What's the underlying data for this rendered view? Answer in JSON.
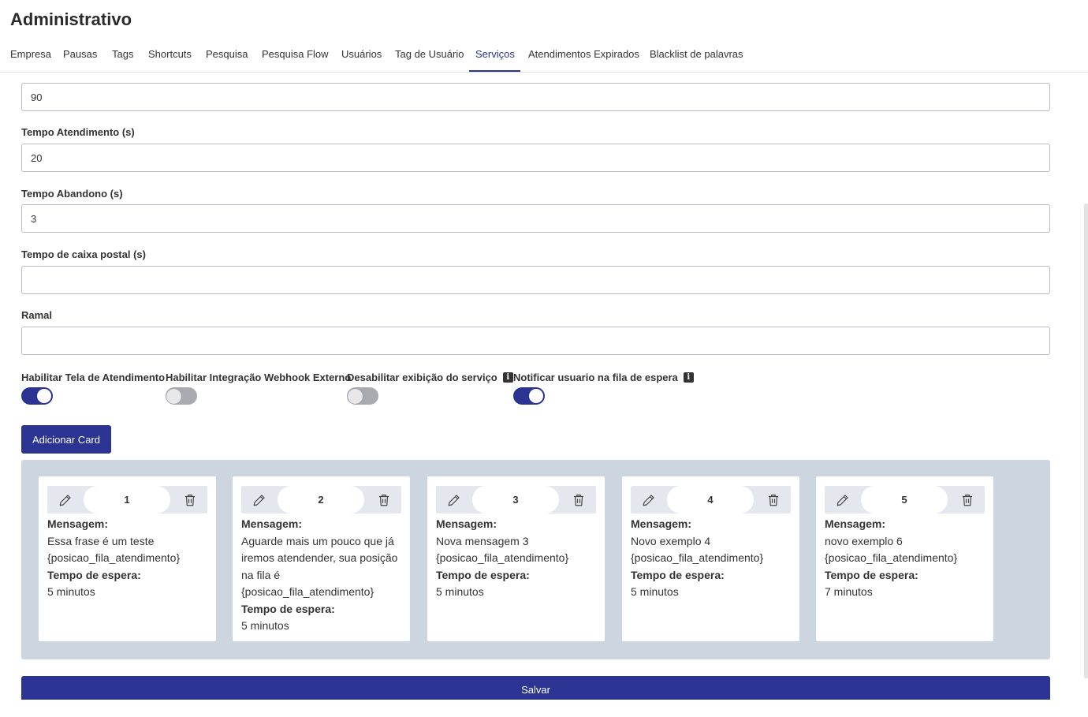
{
  "page": {
    "title": "Administrativo"
  },
  "tabs": [
    {
      "label": "Empresa"
    },
    {
      "label": "Pausas"
    },
    {
      "label": "Tags"
    },
    {
      "label": "Shortcuts"
    },
    {
      "label": "Pesquisa"
    },
    {
      "label": "Pesquisa Flow"
    },
    {
      "label": "Usuários"
    },
    {
      "label": "Tag de Usuário"
    },
    {
      "label": "Serviços",
      "active": true
    },
    {
      "label": "Atendimentos Expirados"
    },
    {
      "label": "Blacklist de palavras"
    }
  ],
  "form": {
    "top_field": {
      "value": "90"
    },
    "tempo_atendimento": {
      "label": "Tempo Atendimento (s)",
      "value": "20"
    },
    "tempo_abandono": {
      "label": "Tempo Abandono (s)",
      "value": "3"
    },
    "tempo_caixa_postal": {
      "label": "Tempo de caixa postal (s)",
      "value": ""
    },
    "ramal": {
      "label": "Ramal",
      "value": ""
    }
  },
  "toggles": [
    {
      "label": "Habilitar Tela de Atendimento",
      "on": true,
      "info": false
    },
    {
      "label": "Habilitar Integração Webhook Externo",
      "on": false,
      "info": false
    },
    {
      "label": "Desabilitar exibição do serviço",
      "on": false,
      "info": true
    },
    {
      "label": "Notificar usuario na fila de espera",
      "on": true,
      "info": true
    }
  ],
  "info_icon_glyph": "i",
  "add_card_label": "Adicionar Card",
  "cards_labels": {
    "message": "Mensagem:",
    "wait": "Tempo de espera:"
  },
  "cards": [
    {
      "number": "1",
      "message": "Essa frase é um teste {posicao_fila_atendimento}",
      "wait": "5 minutos"
    },
    {
      "number": "2",
      "message": "Aguarde mais um pouco que já iremos atendender, sua posição na fila é {posicao_fila_atendimento}",
      "wait": "5 minutos"
    },
    {
      "number": "3",
      "message": "Nova mensagem 3 {posicao_fila_atendimento}",
      "wait": "5 minutos"
    },
    {
      "number": "4",
      "message": "Novo exemplo 4 {posicao_fila_atendimento}",
      "wait": "5 minutos"
    },
    {
      "number": "5",
      "message": "novo exemplo 6 {posicao_fila_atendimento}",
      "wait": "7 minutos"
    }
  ],
  "save_label": "Salvar",
  "icons": {
    "edit": "pencil-icon",
    "delete": "trash-icon",
    "info": "info-icon"
  },
  "colors": {
    "primary": "#2b3493",
    "cards_background": "#cdd5e0",
    "toggle_off": "#a8aab0"
  }
}
